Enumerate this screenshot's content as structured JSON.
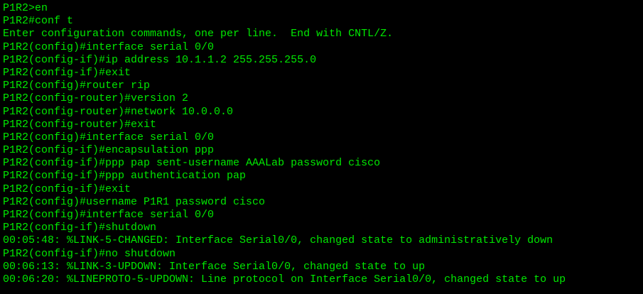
{
  "terminal": {
    "text_color": "#00e800",
    "background_color": "#000000",
    "lines": [
      "P1R2>en",
      "P1R2#conf t",
      "Enter configuration commands, one per line.  End with CNTL/Z.",
      "P1R2(config)#interface serial 0/0",
      "P1R2(config-if)#ip address 10.1.1.2 255.255.255.0",
      "P1R2(config-if)#exit",
      "P1R2(config)#router rip",
      "P1R2(config-router)#version 2",
      "P1R2(config-router)#network 10.0.0.0",
      "P1R2(config-router)#exit",
      "P1R2(config)#interface serial 0/0",
      "P1R2(config-if)#encapsulation ppp",
      "P1R2(config-if)#ppp pap sent-username AAALab password cisco",
      "P1R2(config-if)#ppp authentication pap",
      "P1R2(config-if)#exit",
      "P1R2(config)#username P1R1 password cisco",
      "P1R2(config)#interface serial 0/0",
      "P1R2(config-if)#shutdown",
      "00:05:48: %LINK-5-CHANGED: Interface Serial0/0, changed state to administratively down",
      "P1R2(config-if)#no shutdown",
      "00:06:13: %LINK-3-UPDOWN: Interface Serial0/0, changed state to up",
      "00:06:20: %LINEPROTO-5-UPDOWN: Line protocol on Interface Serial0/0, changed state to up"
    ]
  }
}
